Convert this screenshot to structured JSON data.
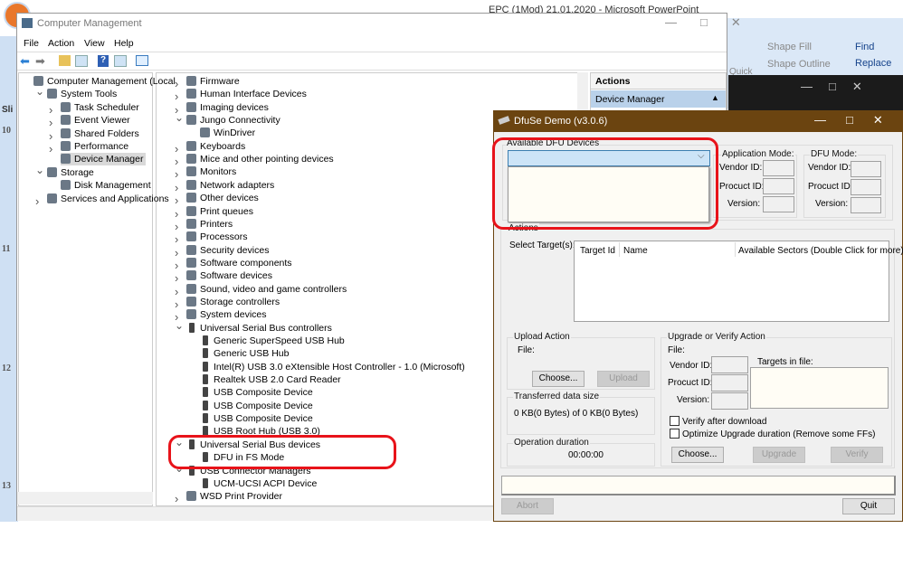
{
  "powerpoint": {
    "title": "EPC (1Mod) 21.01.2020 - Microsoft PowerPoint",
    "ribbon": {
      "shape_fill": "Shape Fill",
      "shape_outline": "Shape Outline",
      "quick": "Quick",
      "find": "Find",
      "replace": "Replace"
    },
    "slide_numbers": [
      "10",
      "11",
      "12",
      "13"
    ],
    "tab": "Sli"
  },
  "computer_management": {
    "title": "Computer Management",
    "menu": [
      "File",
      "Action",
      "View",
      "Help"
    ],
    "nav_tree": [
      {
        "label": "Computer Management (Local",
        "level": 0,
        "expander": ""
      },
      {
        "label": "System Tools",
        "level": 1,
        "expander": "v"
      },
      {
        "label": "Task Scheduler",
        "level": 2,
        "expander": ">"
      },
      {
        "label": "Event Viewer",
        "level": 2,
        "expander": ">"
      },
      {
        "label": "Shared Folders",
        "level": 2,
        "expander": ">"
      },
      {
        "label": "Performance",
        "level": 2,
        "expander": ">"
      },
      {
        "label": "Device Manager",
        "level": 2,
        "expander": "",
        "selected": true
      },
      {
        "label": "Storage",
        "level": 1,
        "expander": "v"
      },
      {
        "label": "Disk Management",
        "level": 2,
        "expander": ""
      },
      {
        "label": "Services and Applications",
        "level": 1,
        "expander": ">"
      }
    ],
    "device_tree": [
      {
        "label": "Firmware",
        "level": 0,
        "expander": ">"
      },
      {
        "label": "Human Interface Devices",
        "level": 0,
        "expander": ">"
      },
      {
        "label": "Imaging devices",
        "level": 0,
        "expander": ">"
      },
      {
        "label": "Jungo Connectivity",
        "level": 0,
        "expander": "v"
      },
      {
        "label": "WinDriver",
        "level": 1,
        "expander": ""
      },
      {
        "label": "Keyboards",
        "level": 0,
        "expander": ">"
      },
      {
        "label": "Mice and other pointing devices",
        "level": 0,
        "expander": ">"
      },
      {
        "label": "Monitors",
        "level": 0,
        "expander": ">"
      },
      {
        "label": "Network adapters",
        "level": 0,
        "expander": ">"
      },
      {
        "label": "Other devices",
        "level": 0,
        "expander": ">"
      },
      {
        "label": "Print queues",
        "level": 0,
        "expander": ">"
      },
      {
        "label": "Printers",
        "level": 0,
        "expander": ">"
      },
      {
        "label": "Processors",
        "level": 0,
        "expander": ">"
      },
      {
        "label": "Security devices",
        "level": 0,
        "expander": ">"
      },
      {
        "label": "Software components",
        "level": 0,
        "expander": ">"
      },
      {
        "label": "Software devices",
        "level": 0,
        "expander": ">"
      },
      {
        "label": "Sound, video and game controllers",
        "level": 0,
        "expander": ">"
      },
      {
        "label": "Storage controllers",
        "level": 0,
        "expander": ">"
      },
      {
        "label": "System devices",
        "level": 0,
        "expander": ">"
      },
      {
        "label": "Universal Serial Bus controllers",
        "level": 0,
        "expander": "v",
        "usb": true
      },
      {
        "label": "Generic SuperSpeed USB Hub",
        "level": 1,
        "expander": "",
        "usb": true
      },
      {
        "label": "Generic USB Hub",
        "level": 1,
        "expander": "",
        "usb": true
      },
      {
        "label": "Intel(R) USB 3.0 eXtensible Host Controller - 1.0 (Microsoft)",
        "level": 1,
        "expander": "",
        "usb": true
      },
      {
        "label": "Realtek USB 2.0 Card Reader",
        "level": 1,
        "expander": "",
        "usb": true
      },
      {
        "label": "USB Composite Device",
        "level": 1,
        "expander": "",
        "usb": true
      },
      {
        "label": "USB Composite Device",
        "level": 1,
        "expander": "",
        "usb": true
      },
      {
        "label": "USB Composite Device",
        "level": 1,
        "expander": "",
        "usb": true
      },
      {
        "label": "USB Root Hub (USB 3.0)",
        "level": 1,
        "expander": "",
        "usb": true
      },
      {
        "label": "Universal Serial Bus devices",
        "level": 0,
        "expander": "v",
        "usb": true
      },
      {
        "label": "DFU in FS Mode",
        "level": 1,
        "expander": "",
        "usb": true
      },
      {
        "label": "USB Connector Managers",
        "level": 0,
        "expander": "v",
        "usb": true
      },
      {
        "label": "UCM-UCSI ACPI Device",
        "level": 1,
        "expander": "",
        "usb": true
      },
      {
        "label": "WSD Print Provider",
        "level": 0,
        "expander": ">"
      }
    ],
    "actions": {
      "header": "Actions",
      "section": "Device Manager"
    }
  },
  "dfuse": {
    "title": "DfuSe Demo (v3.0.6)",
    "available_label": "Available DFU Devices",
    "available_value": "",
    "app_mode": {
      "label": "Application Mode:",
      "vendor": "Vendor ID:",
      "product": "Procuct ID:",
      "version": "Version:"
    },
    "dfu_mode": {
      "label": "DFU Mode:",
      "vendor": "Vendor ID:",
      "product": "Procuct ID:",
      "version": "Version:"
    },
    "actions_label": "Actions",
    "select_targets": "Select Target(s):",
    "columns": [
      "Target Id",
      "Name",
      "Available Sectors (Double Click for more)"
    ],
    "upload": {
      "label": "Upload Action",
      "file": "File:",
      "choose": "Choose...",
      "upload": "Upload"
    },
    "transferred": {
      "label": "Transferred data size",
      "value": "0 KB(0 Bytes) of 0 KB(0 Bytes)"
    },
    "duration": {
      "label": "Operation duration",
      "value": "00:00:00"
    },
    "upgrade": {
      "label": "Upgrade or Verify Action",
      "file": "File:",
      "vendor": "Vendor ID:",
      "product": "Procuct ID:",
      "version": "Version:",
      "targets": "Targets in file:",
      "verify_after": "Verify after download",
      "optimize": "Optimize Upgrade duration (Remove some FFs)",
      "choose": "Choose...",
      "upgrade": "Upgrade",
      "verify": "Verify"
    },
    "abort": "Abort",
    "quit": "Quit"
  },
  "colors": {
    "dfuse_titlebar": "#6b4410",
    "highlight": "#e8131a",
    "combo": "#cce4f7"
  }
}
